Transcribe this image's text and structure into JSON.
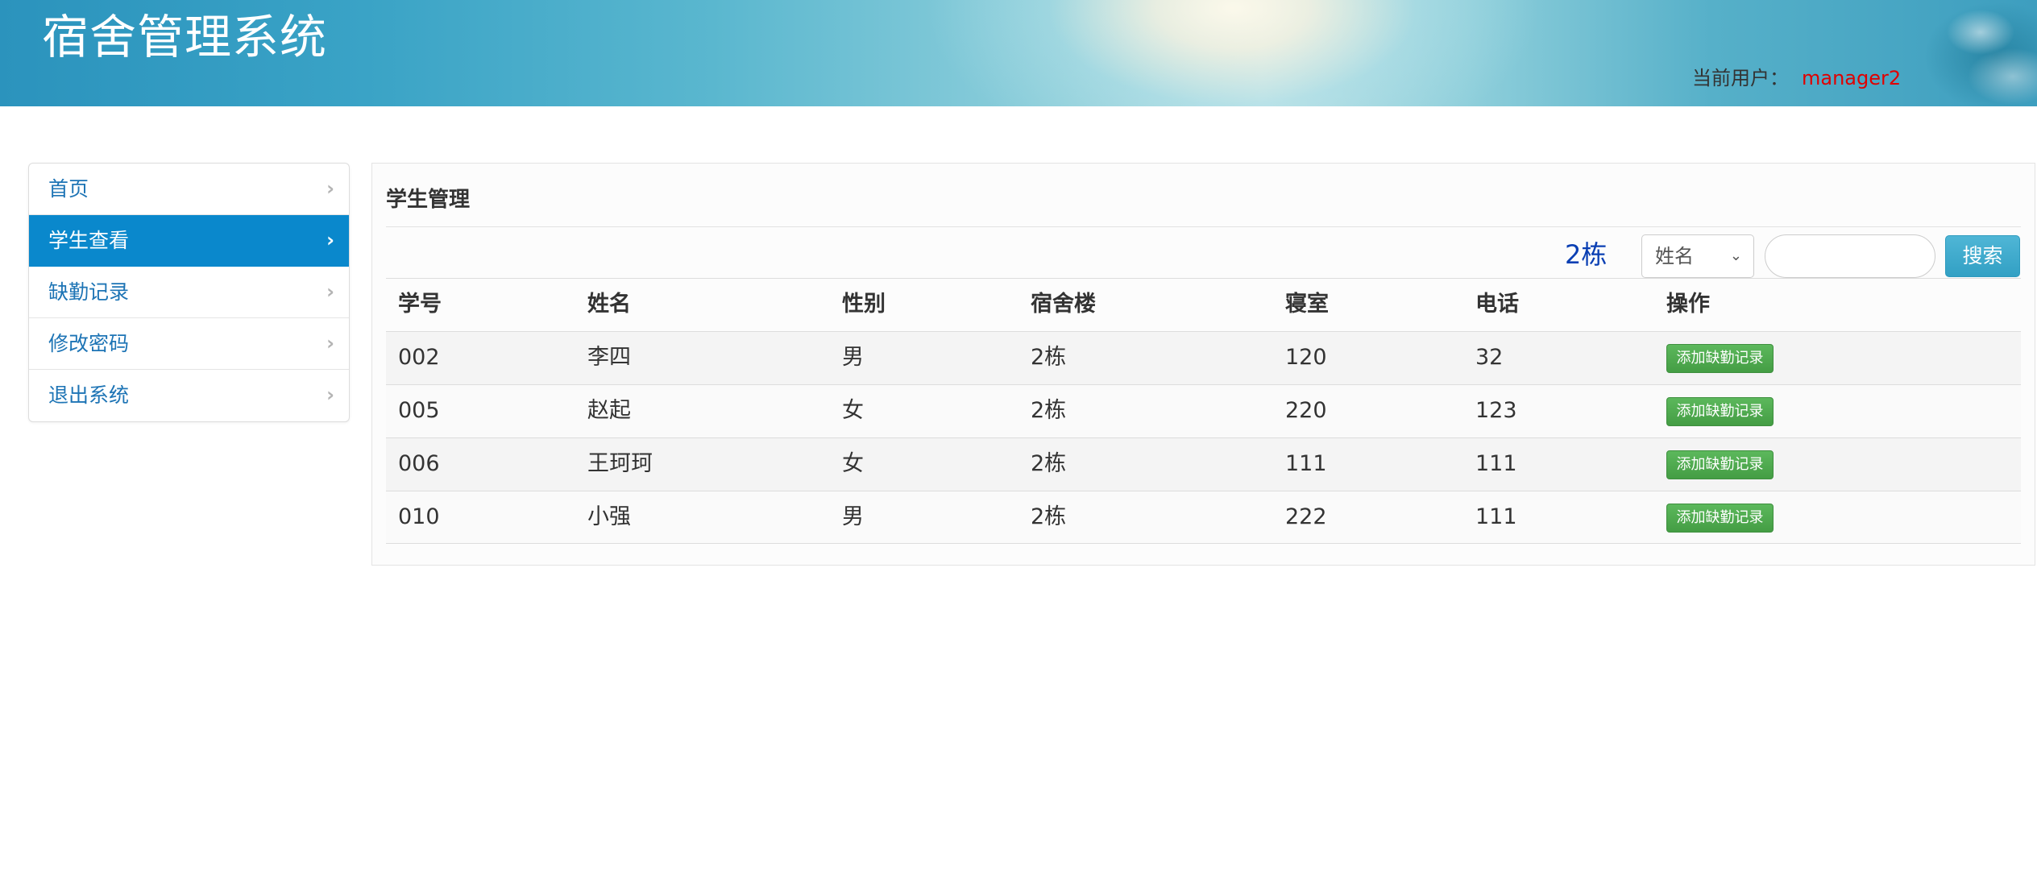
{
  "header": {
    "title": "宿舍管理系统",
    "user_label": "当前用户：",
    "username": "manager2"
  },
  "sidebar": {
    "items": [
      {
        "label": "首页",
        "icon": "chevron-right-icon",
        "active": false
      },
      {
        "label": "学生查看",
        "icon": "chevron-right-icon",
        "active": true
      },
      {
        "label": "缺勤记录",
        "icon": "chevron-right-icon",
        "active": false
      },
      {
        "label": "修改密码",
        "icon": "chevron-right-icon",
        "active": false
      },
      {
        "label": "退出系统",
        "icon": "chevron-right-icon",
        "active": false
      }
    ],
    "chevron_glyph": "›"
  },
  "main": {
    "title": "学生管理",
    "building": "2栋",
    "search": {
      "field_selected": "姓名",
      "query": "",
      "button_label": "搜索"
    },
    "table": {
      "columns": [
        "学号",
        "姓名",
        "性别",
        "宿舍楼",
        "寝室",
        "电话",
        "操作"
      ],
      "rows": [
        {
          "id": "002",
          "name": "李四",
          "gender": "男",
          "building": "2栋",
          "room": "120",
          "phone": "32",
          "action": "添加缺勤记录"
        },
        {
          "id": "005",
          "name": "赵起",
          "gender": "女",
          "building": "2栋",
          "room": "220",
          "phone": "123",
          "action": "添加缺勤记录"
        },
        {
          "id": "006",
          "name": "王珂珂",
          "gender": "女",
          "building": "2栋",
          "room": "111",
          "phone": "111",
          "action": "添加缺勤记录"
        },
        {
          "id": "010",
          "name": "小强",
          "gender": "男",
          "building": "2栋",
          "room": "222",
          "phone": "111",
          "action": "添加缺勤记录"
        }
      ]
    }
  },
  "colors": {
    "header_start": "#2b93bd",
    "nav_link": "#1d74b5",
    "nav_active_bg": "#0a88cc",
    "username": "#e00000",
    "building_text": "#0a3fb3",
    "search_button": "#32a0c4",
    "action_button": "#5cb85c"
  }
}
